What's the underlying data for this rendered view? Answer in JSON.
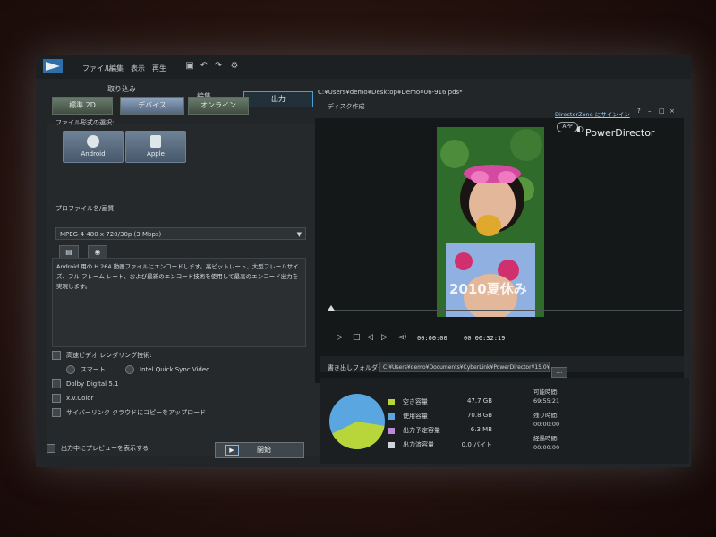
{
  "menu": {
    "file": "ファイル",
    "edit": "編集",
    "view": "表示",
    "playback": "再生"
  },
  "modes": {
    "capture": "取り込み",
    "edit": "編集",
    "output": "出力",
    "disc": "ディスク作成"
  },
  "project_path": "C:¥Users¥demo¥Desktop¥Demo¥06-916.pds*",
  "subtabs": {
    "standard2d": "標準 2D",
    "device": "デバイス",
    "online": "オンライン"
  },
  "format": {
    "label": "ファイル形式の選択:",
    "android": "Android",
    "apple": "Apple"
  },
  "profile": {
    "label": "プロファイル名/画質:",
    "value": "MPEG-4 480 x 720/30p (3 Mbps)"
  },
  "description": "Android 用の H.264 動画ファイルにエンコードします。高ビットレート、大型フレームサイズ、フル フレーム レート、および最新のエンコード技術を使用して最高のエンコード出力を実現します。",
  "options": {
    "fast_render": "高速ビデオ レンダリング技術:",
    "smart": "スマート...",
    "intel_qsv": "Intel Quick Sync Video",
    "dolby": "Dolby Digital 5.1",
    "xvcolor": "x.v.Color",
    "cyberlink_cloud": "サイバーリンク クラウドにコピーをアップロード",
    "preview_during": "出力中にプレビューを表示する"
  },
  "start_button": "開始",
  "header_right": {
    "directorzone": "DirectorZone にサインイン",
    "app": "APP",
    "brand": "PowerDirector",
    "win_controls": [
      "?",
      "–",
      "□",
      "×"
    ]
  },
  "video_overlay_text": "2010夏休み",
  "playback": {
    "current": "00:00:00",
    "total": "00:00:32:19"
  },
  "output_folder": {
    "label": "書き出しフォルダー:",
    "path": "C:¥Users¥demo¥Documents¥CyberLink¥PowerDirector¥15.0¥",
    "browse": "..."
  },
  "storage": [
    {
      "label": "空き容量",
      "value": "47.7 GB",
      "color": "#b8d63a"
    },
    {
      "label": "使用容量",
      "value": "70.8 GB",
      "color": "#5aa6e0"
    },
    {
      "label": "出力予定容量",
      "value": "6.3 MB",
      "color": "#b98ad6"
    },
    {
      "label": "出力済容量",
      "value": "0.0 バイト",
      "color": "#cfd4d8"
    }
  ],
  "times": [
    {
      "label": "可能時間:",
      "value": "69:55:21"
    },
    {
      "label": "残り時間:",
      "value": "00:00:00"
    },
    {
      "label": "経過時間:",
      "value": "00:00:00"
    }
  ],
  "pie": {
    "free_fraction": 0.403
  }
}
